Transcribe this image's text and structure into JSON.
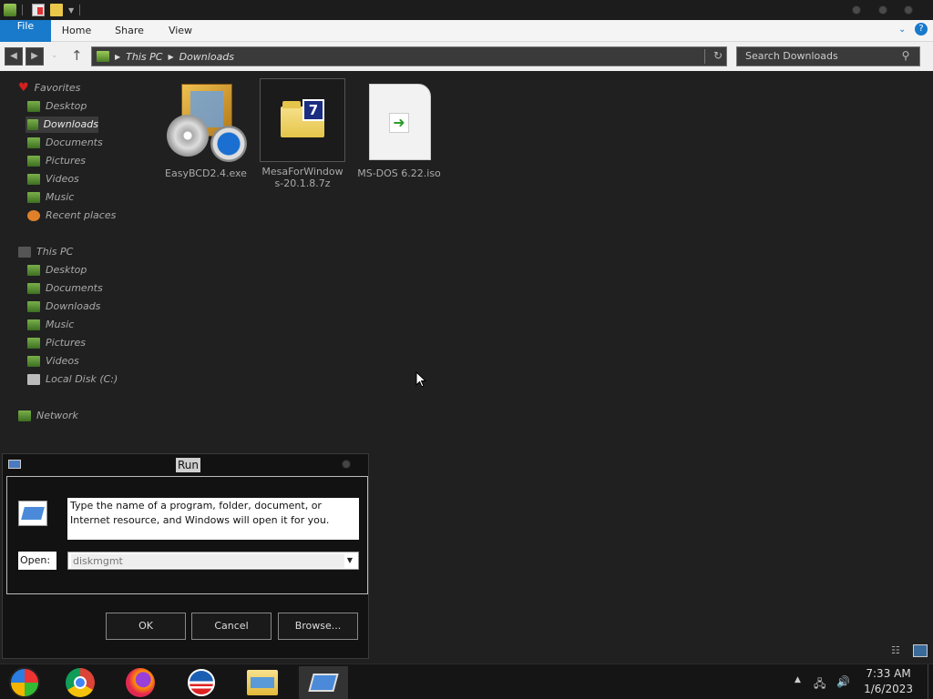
{
  "ribbon": {
    "tabs": [
      "File",
      "Home",
      "Share",
      "View"
    ]
  },
  "address": {
    "crumbs": [
      "This PC",
      "Downloads"
    ],
    "search_placeholder": "Search Downloads"
  },
  "nav": {
    "favorites_header": "Favorites",
    "favorites": [
      "Desktop",
      "Downloads",
      "Documents",
      "Pictures",
      "Videos",
      "Music",
      "Recent places"
    ],
    "thispc_header": "This PC",
    "thispc": [
      "Desktop",
      "Documents",
      "Downloads",
      "Music",
      "Pictures",
      "Videos",
      "Local Disk (C:)"
    ],
    "network": "Network",
    "selected": "Downloads"
  },
  "files": [
    {
      "name": "EasyBCD2.4.exe",
      "icon": "setup-icon"
    },
    {
      "name": "MesaForWindows-20.1.8.7z",
      "icon": "7z-archive-icon"
    },
    {
      "name": "MS-DOS 6.22.iso",
      "icon": "iso-file-icon"
    }
  ],
  "run_dialog": {
    "title": "Run",
    "description": "Type the name of a program, folder, document, or Internet resource, and Windows will open it for you.",
    "open_label": "Open:",
    "open_value": "diskmgmt",
    "ok": "OK",
    "cancel": "Cancel",
    "browse": "Browse..."
  },
  "taskbar": {
    "apps": [
      "start-orb-icon",
      "chrome-icon",
      "firefox-icon",
      "obama-logo-icon",
      "file-explorer-icon",
      "run-icon"
    ],
    "time": "7:33 AM",
    "date": "1/6/2023"
  },
  "colors": {
    "file_tab": "#1979ca",
    "background": "#202020"
  }
}
